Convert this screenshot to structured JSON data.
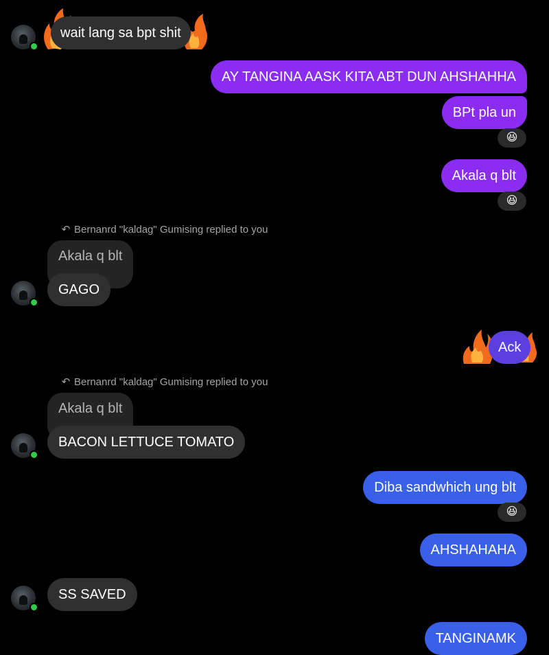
{
  "messages": {
    "m1": "wait lang sa bpt shit",
    "m2": "AY TANGINA AASK KITA ABT DUN AHSHAHHA",
    "m3": "BPt pla un",
    "m4": "Akala q blt",
    "reply1_meta": "Bernanrd \"kaldag\" Gumising replied to you",
    "reply1_quote": "Akala q blt",
    "m5": "GAGO",
    "m6": "Ack",
    "reply2_meta": "Bernanrd \"kaldag\" Gumising replied to you",
    "reply2_quote": "Akala q blt",
    "m7": "BACON LETTUCE TOMATO",
    "m8": "Diba sandwhich ung blt",
    "m9": "AHSHAHAHA",
    "m10": "SS SAVED",
    "m11": "TANGINAMK"
  },
  "reactions": {
    "r1": "😆",
    "r2": "😆",
    "r3": "😆"
  },
  "colors": {
    "background": "#000000",
    "incoming_bubble": "#303030",
    "outgoing_purple": "#8b2df0",
    "outgoing_blue": "#3a5fe8",
    "online_indicator": "#31cc46"
  },
  "icons": {
    "reply": "reply-arrow-icon",
    "flame": "fire-effect-icon",
    "avatar": "contact-avatar"
  }
}
